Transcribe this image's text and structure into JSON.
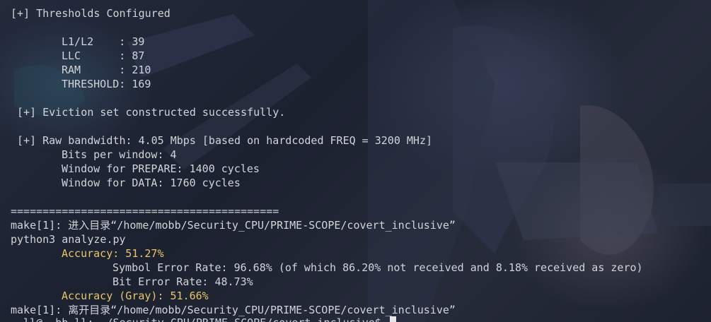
{
  "terminal": {
    "lines": {
      "thresholds_header": "[+] Thresholds Configured",
      "l1l2": "L1/L2    : 39",
      "llc": "LLC      : 87",
      "ram": "RAM      : 210",
      "threshold": "THRESHOLD: 169",
      "eviction": "[+] Eviction set constructed successfully.",
      "bandwidth": "[+] Raw bandwidth: 4.05 Mbps [based on hardcoded FREQ = 3200 MHz]",
      "bits_per_window": "Bits per window: 4",
      "window_prepare": "Window for PREPARE: 1400 cycles",
      "window_data": "Window for DATA: 1760 cycles",
      "separator": "==========================================",
      "make_enter": "make[1]: 进入目录“/home/mobb/Security_CPU/PRIME-SCOPE/covert_inclusive”",
      "python_cmd": "python3 analyze.py",
      "accuracy": "Accuracy: 51.27%",
      "symbol_error": "Symbol Error Rate: 96.68% (of which 86.20% not received and 8.18% received as zero)",
      "bit_error": "Bit Error Rate: 48.73%",
      "accuracy_gray": "Accuracy (Gray): 51.66%",
      "make_leave": "make[1]: 离开目录“/home/mobb/Security_CPU/PRIME-SCOPE/covert_inclusive”",
      "prompt_cut": "_ ll@_ bb ll: ~/Security_CPU/PRIME-SCOPE/covert_inclusive$ "
    },
    "colors": {
      "text": "#d0d4da",
      "highlight": "#e7c66b"
    }
  }
}
